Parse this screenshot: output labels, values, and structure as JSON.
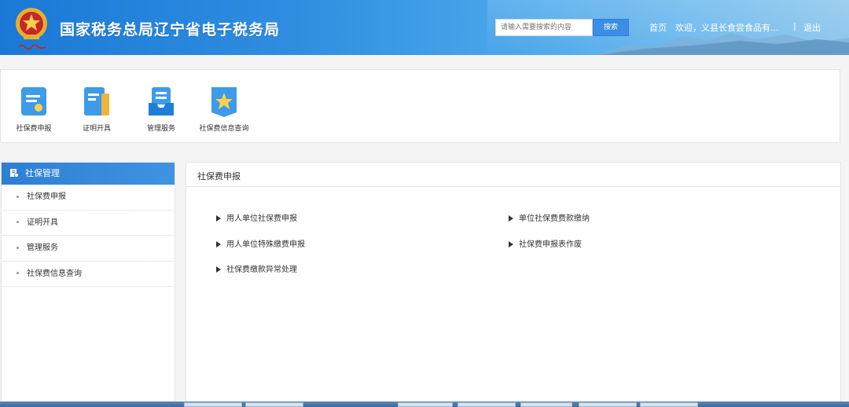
{
  "header": {
    "title": "国家税务总局辽宁省电子税务局",
    "search_placeholder": "请输入需要搜索的内容",
    "search_button": "搜索",
    "home": "首页",
    "welcome": "欢迎，义县长食尝食品有...",
    "separator": "|",
    "logout": "退出"
  },
  "quick_menu": [
    {
      "label": "社保费申报",
      "icon": "document-icon"
    },
    {
      "label": "证明开具",
      "icon": "certificate-icon"
    },
    {
      "label": "管理服务",
      "icon": "tray-icon"
    },
    {
      "label": "社保费信息查询",
      "icon": "star-badge-icon"
    }
  ],
  "sidebar": {
    "title": "社保管理",
    "items": [
      {
        "label": "社保费申报"
      },
      {
        "label": "证明开具"
      },
      {
        "label": "管理服务"
      },
      {
        "label": "社保费信息查询"
      }
    ]
  },
  "main": {
    "title": "社保费申报",
    "links": [
      {
        "label": "用人单位社保费申报"
      },
      {
        "label": "单位社保费费款缴纳"
      },
      {
        "label": "用人单位特殊缴费申报"
      },
      {
        "label": "社保费申报表作废"
      },
      {
        "label": "社保费缴款异常处理"
      }
    ]
  },
  "colors": {
    "header_blue": "#1a79d6",
    "accent_blue": "#3a8ee6"
  }
}
